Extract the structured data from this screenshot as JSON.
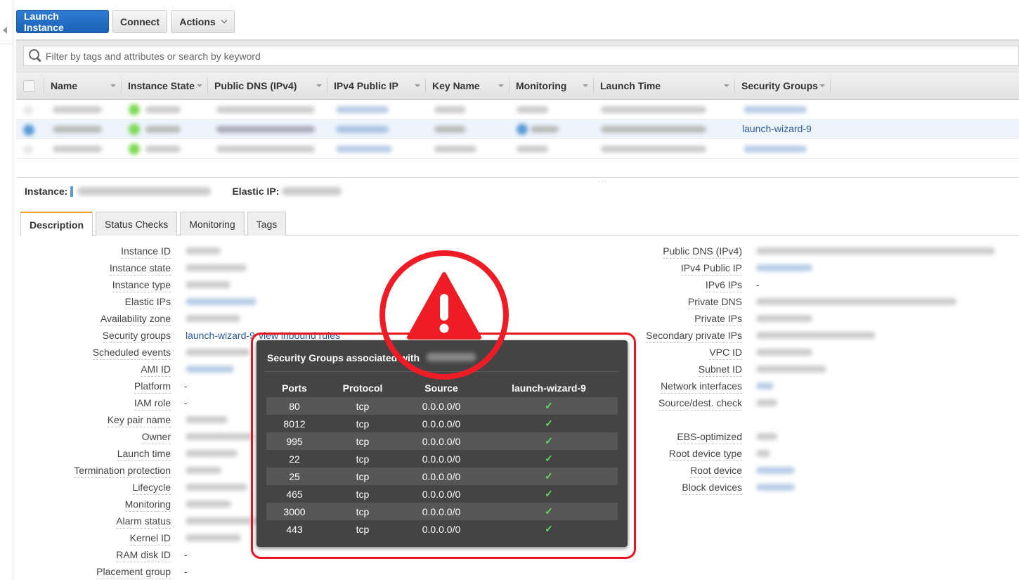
{
  "toolbar": {
    "launch_label": "Launch Instance",
    "connect_label": "Connect",
    "actions_label": "Actions"
  },
  "search": {
    "placeholder": "Filter by tags and attributes or search by keyword",
    "value": ""
  },
  "table": {
    "columns": [
      "Name",
      "Instance State",
      "Public DNS (IPv4)",
      "IPv4 Public IP",
      "Key Name",
      "Monitoring",
      "Launch Time",
      "Security Groups"
    ],
    "rows": [
      {
        "selected": false,
        "security_group": "",
        "redacted": true
      },
      {
        "selected": true,
        "security_group": "launch-wizard-9",
        "redacted": true
      },
      {
        "selected": false,
        "security_group": "",
        "redacted": true
      }
    ]
  },
  "details": {
    "instance_label": "Instance:",
    "elastic_ip_label": "Elastic IP:",
    "tabs": [
      "Description",
      "Status Checks",
      "Monitoring",
      "Tags"
    ],
    "active_tab": "Description",
    "left_fields": [
      {
        "label": "Instance ID",
        "value": ""
      },
      {
        "label": "Instance state",
        "value": ""
      },
      {
        "label": "Instance type",
        "value": ""
      },
      {
        "label": "Elastic IPs",
        "value": ""
      },
      {
        "label": "Availability zone",
        "value": ""
      },
      {
        "label": "Security groups",
        "value": "launch-wizard-9",
        "extra": "view inbound rules"
      },
      {
        "label": "Scheduled events",
        "value": ""
      },
      {
        "label": "AMI ID",
        "value": ""
      },
      {
        "label": "Platform",
        "value": "-"
      },
      {
        "label": "IAM role",
        "value": "-"
      },
      {
        "label": "Key pair name",
        "value": ""
      },
      {
        "label": "Owner",
        "value": ""
      },
      {
        "label": "Launch time",
        "value": ""
      },
      {
        "label": "Termination protection",
        "value": ""
      },
      {
        "label": "Lifecycle",
        "value": ""
      },
      {
        "label": "Monitoring",
        "value": ""
      },
      {
        "label": "Alarm status",
        "value": ""
      },
      {
        "label": "Kernel ID",
        "value": ""
      },
      {
        "label": "RAM disk ID",
        "value": "-"
      },
      {
        "label": "Placement group",
        "value": "-"
      }
    ],
    "right_fields": [
      {
        "label": "Public DNS (IPv4)",
        "value": ""
      },
      {
        "label": "IPv4 Public IP",
        "value": ""
      },
      {
        "label": "IPv6 IPs",
        "value": "-"
      },
      {
        "label": "Private DNS",
        "value": ""
      },
      {
        "label": "Private IPs",
        "value": ""
      },
      {
        "label": "Secondary private IPs",
        "value": ""
      },
      {
        "label": "VPC ID",
        "value": ""
      },
      {
        "label": "Subnet ID",
        "value": ""
      },
      {
        "label": "Network interfaces",
        "value": ""
      },
      {
        "label": "Source/dest. check",
        "value": ""
      },
      {
        "label": "",
        "value": ""
      },
      {
        "label": "EBS-optimized",
        "value": ""
      },
      {
        "label": "Root device type",
        "value": ""
      },
      {
        "label": "Root device",
        "value": ""
      },
      {
        "label": "Block devices",
        "value": ""
      }
    ]
  },
  "popup": {
    "title": "Security Groups associated with",
    "columns": [
      "Ports",
      "Protocol",
      "Source",
      "launch-wizard-9"
    ],
    "rules": [
      {
        "port": "80",
        "protocol": "tcp",
        "source": "0.0.0.0/0",
        "allowed": "✓"
      },
      {
        "port": "8012",
        "protocol": "tcp",
        "source": "0.0.0.0/0",
        "allowed": "✓"
      },
      {
        "port": "995",
        "protocol": "tcp",
        "source": "0.0.0.0/0",
        "allowed": "✓"
      },
      {
        "port": "22",
        "protocol": "tcp",
        "source": "0.0.0.0/0",
        "allowed": "✓"
      },
      {
        "port": "25",
        "protocol": "tcp",
        "source": "0.0.0.0/0",
        "allowed": "✓"
      },
      {
        "port": "465",
        "protocol": "tcp",
        "source": "0.0.0.0/0",
        "allowed": "✓"
      },
      {
        "port": "3000",
        "protocol": "tcp",
        "source": "0.0.0.0/0",
        "allowed": "✓"
      },
      {
        "port": "443",
        "protocol": "tcp",
        "source": "0.0.0.0/0",
        "allowed": "✓"
      }
    ]
  },
  "annotation": {
    "icon": "warning-triangle-icon",
    "color": "#ee1c24"
  },
  "colors": {
    "primary": "#1f6ac2",
    "link": "#2a5a96",
    "tab_accent": "#f0a030",
    "check": "#5fdc5f",
    "popup_bg": "#444444"
  }
}
